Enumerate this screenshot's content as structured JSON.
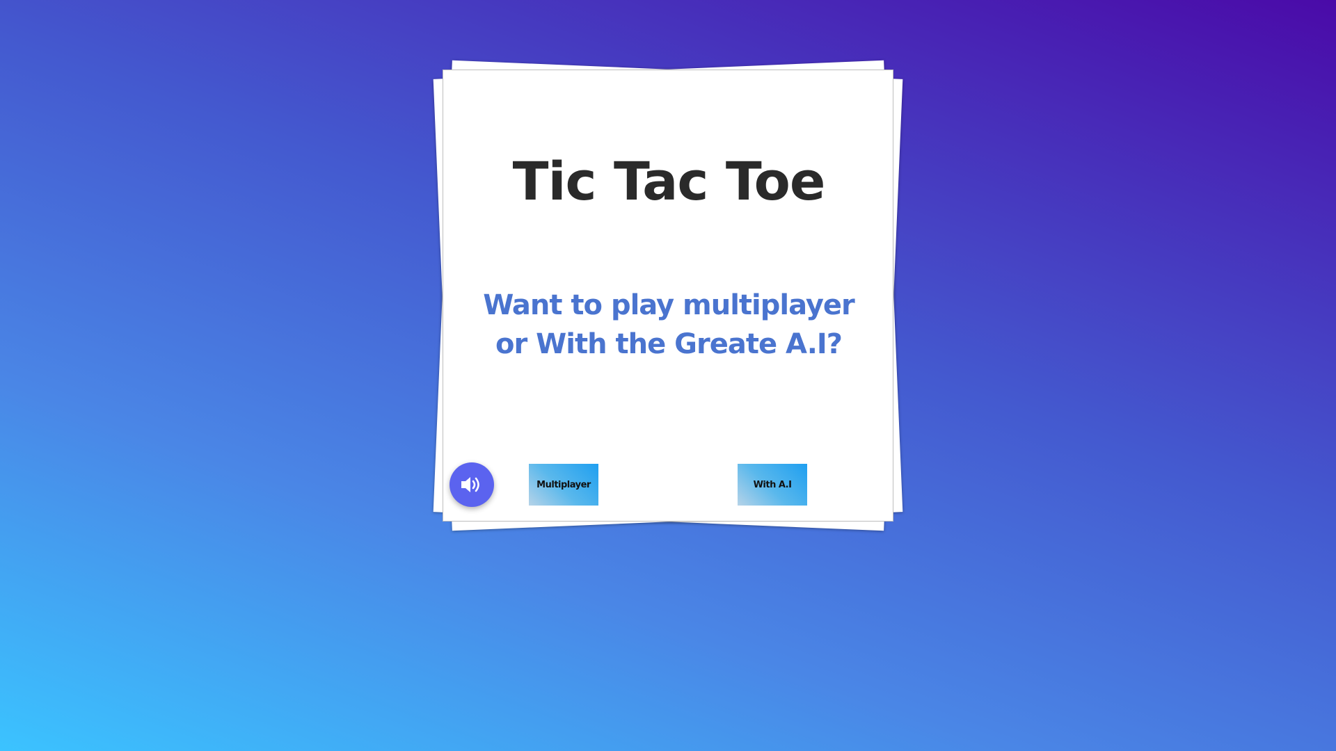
{
  "game": {
    "title": "Tic Tac Toe",
    "prompt": "Want to play multiplayer or With the Greate A.I?",
    "buttons": {
      "multiplayer": "Multiplayer",
      "ai": "With A.I"
    },
    "sound": {
      "icon": "speaker-volume-icon",
      "state": "on"
    }
  },
  "colors": {
    "title": "#2a2a2a",
    "prompt": "#4a74cf",
    "sound_button": "#5b63ef",
    "button_gradient_start": "#b6d3e8",
    "button_gradient_end": "#1f9ff0"
  }
}
